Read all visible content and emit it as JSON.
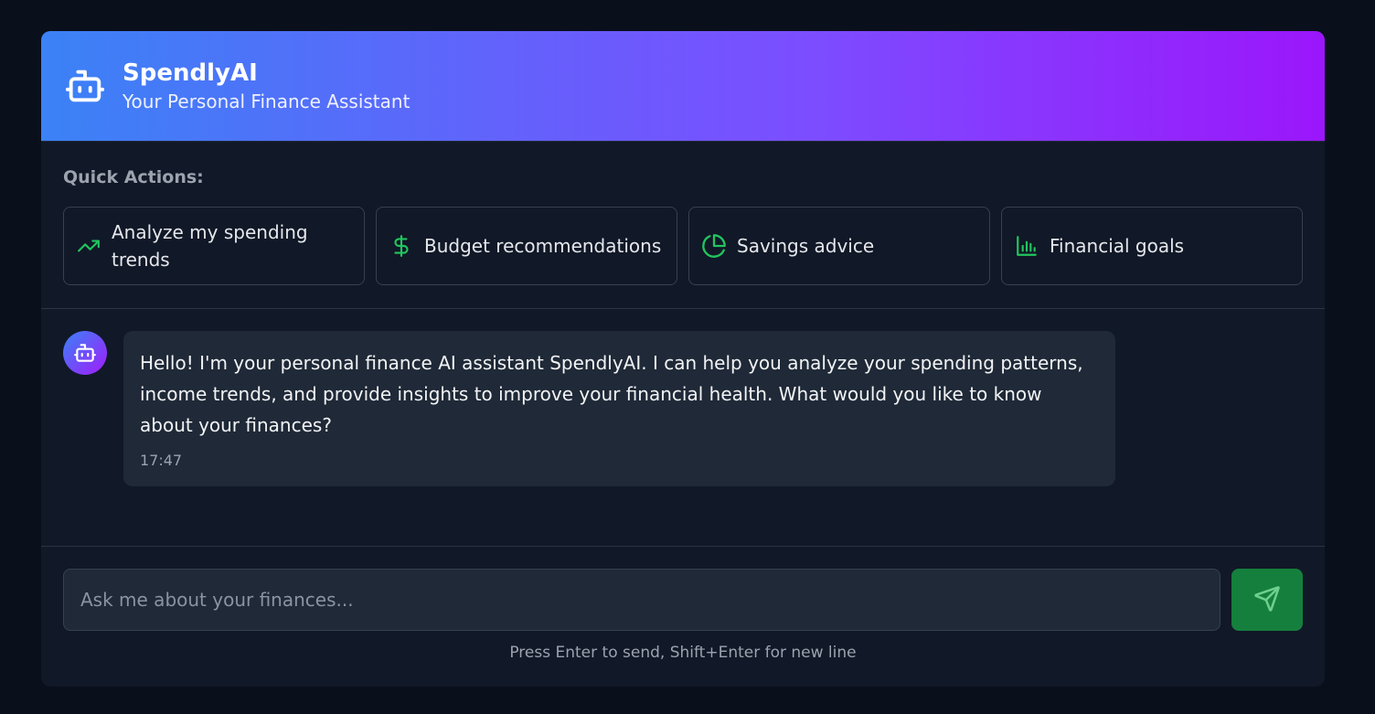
{
  "header": {
    "title": "SpendlyAI",
    "subtitle": "Your Personal Finance Assistant",
    "icon": "bot-icon"
  },
  "quick_actions": {
    "label": "Quick Actions:",
    "items": [
      {
        "label": "Analyze my spending trends",
        "icon": "trending-up-icon"
      },
      {
        "label": "Budget recommendations",
        "icon": "dollar-icon"
      },
      {
        "label": "Savings advice",
        "icon": "pie-chart-icon"
      },
      {
        "label": "Financial goals",
        "icon": "bar-chart-icon"
      }
    ]
  },
  "messages": [
    {
      "sender": "assistant",
      "text": "Hello! I'm your personal finance AI assistant SpendlyAI. I can help you analyze your spending patterns, income trends, and provide insights to improve your financial health. What would you like to know about your finances?",
      "time": "17:47"
    }
  ],
  "composer": {
    "placeholder": "Ask me about your finances...",
    "value": "",
    "hint": "Press Enter to send, Shift+Enter for new line",
    "send_icon": "send-icon"
  },
  "colors": {
    "accent_green": "#22c55e",
    "send_button": "#15803d",
    "gradient_start": "#3b82f6",
    "gradient_end": "#9b16fb"
  }
}
